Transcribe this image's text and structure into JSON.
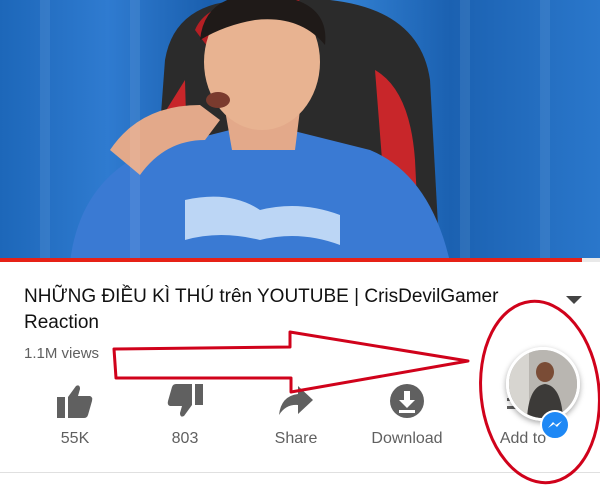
{
  "video": {
    "progress_fraction": 0.97
  },
  "details": {
    "title": "NHỮNG ĐIỀU KÌ THÚ trên YOUTUBE | CrisDevilGamer Reaction",
    "views": "1.1M views"
  },
  "actions": [
    {
      "label": "55K",
      "icon": "thumbs-up-icon"
    },
    {
      "label": "803",
      "icon": "thumbs-down-icon"
    },
    {
      "label": "Share",
      "icon": "share-icon"
    },
    {
      "label": "Download",
      "icon": "download-icon"
    },
    {
      "label": "Add to",
      "icon": "add-to-playlist-icon"
    }
  ],
  "annotation": {
    "color": "#d0021b"
  }
}
